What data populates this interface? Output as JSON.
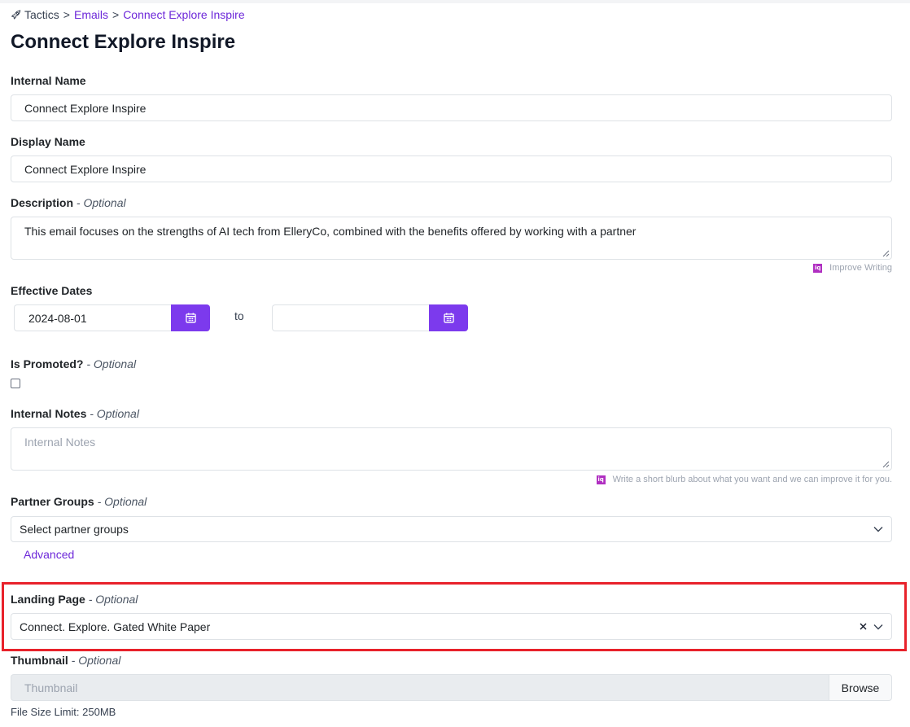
{
  "breadcrumb": {
    "items": [
      "Tactics",
      "Emails",
      "Connect Explore Inspire"
    ],
    "separator": ">"
  },
  "page": {
    "title": "Connect Explore Inspire"
  },
  "form": {
    "optional_suffix": "- Optional",
    "internal_name": {
      "label": "Internal Name",
      "value": "Connect Explore Inspire"
    },
    "display_name": {
      "label": "Display Name",
      "value": "Connect Explore Inspire"
    },
    "description": {
      "label": "Description",
      "value": "This email focuses on the strengths of AI tech from ElleryCo, combined with the benefits offered by working with a partner",
      "helper": "Improve Writing",
      "helper_icon": "iq"
    },
    "effective_dates": {
      "label": "Effective Dates",
      "start": "2024-08-01",
      "end": "",
      "separator": "to"
    },
    "is_promoted": {
      "label": "Is Promoted?",
      "checked": false
    },
    "internal_notes": {
      "label": "Internal Notes",
      "placeholder": "Internal Notes",
      "helper": "Write a short blurb about what you want and we can improve it for you.",
      "helper_icon": "iq"
    },
    "partner_groups": {
      "label": "Partner Groups",
      "placeholder": "Select partner groups",
      "advanced_link": "Advanced"
    },
    "landing_page": {
      "label": "Landing Page",
      "value": "Connect. Explore. Gated White Paper"
    },
    "thumbnail": {
      "label": "Thumbnail",
      "placeholder": "Thumbnail",
      "button": "Browse",
      "limit": "File Size Limit: 250MB"
    }
  },
  "icons": [
    "rocket-icon",
    "calendar-icon",
    "clear-icon",
    "chevron-down-icon",
    "iq-icon"
  ],
  "colors": {
    "accent": "#7c3aed",
    "link": "#6d28d9",
    "highlight": "#e8222b",
    "ai_badge": "#b02fc1"
  }
}
